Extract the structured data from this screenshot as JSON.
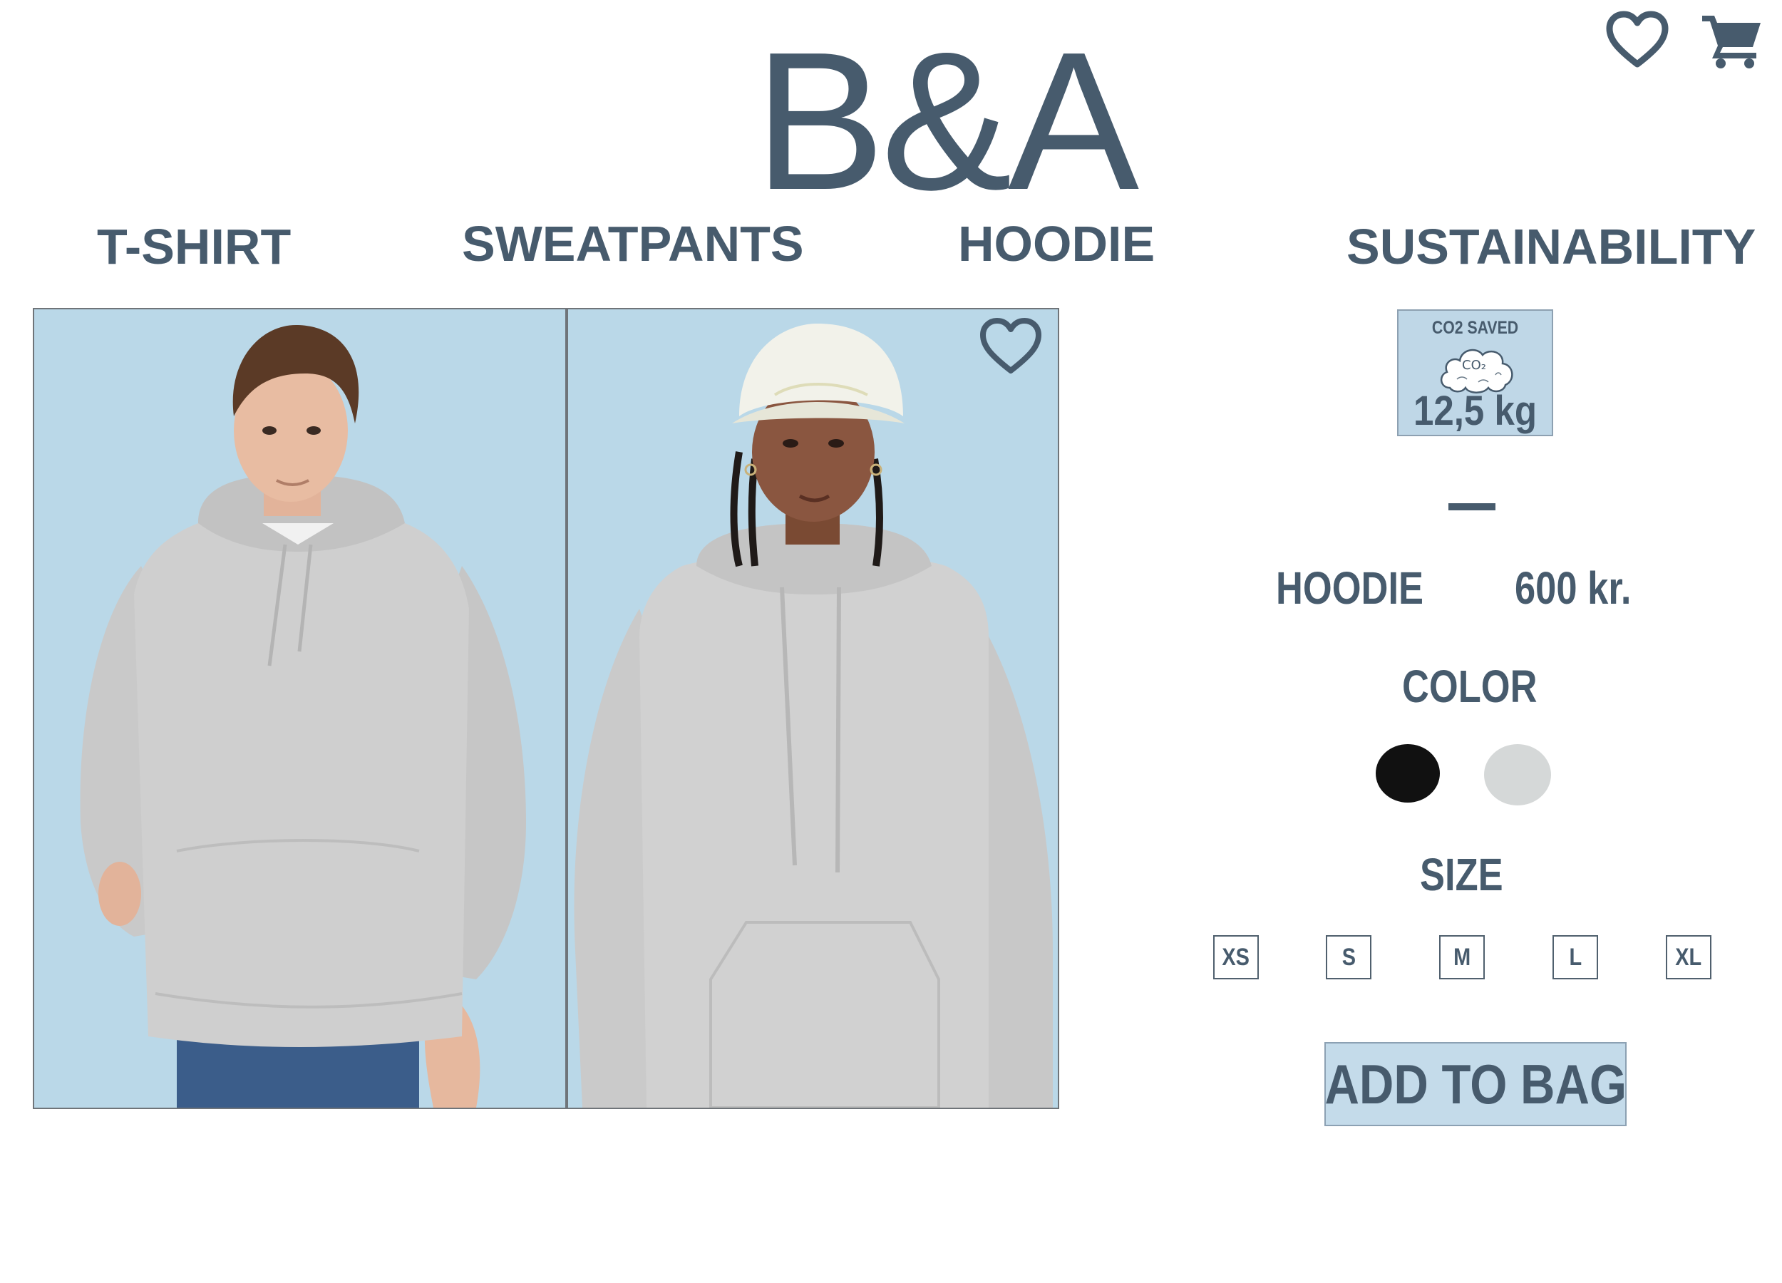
{
  "header": {
    "logo": "B&A",
    "icons": {
      "favorites": "heart-icon",
      "cart": "cart-icon"
    }
  },
  "nav": {
    "items": [
      "T-SHIRT",
      "SWEATPANTS",
      "HOODIE",
      "SUSTAINABILITY"
    ]
  },
  "gallery": {
    "images": [
      "model-man-grey-hoodie",
      "model-woman-grey-hoodie"
    ],
    "favorite_icon": "heart-icon"
  },
  "product": {
    "co2_badge": {
      "title": "CO2 SAVED",
      "cloud_text": "CO₂",
      "value": "12,5 kg"
    },
    "name": "HOODIE",
    "price": "600 kr.",
    "color_label": "COLOR",
    "colors": [
      "#111111",
      "#d5d8d8"
    ],
    "size_label": "SIZE",
    "sizes": [
      "XS",
      "S",
      "M",
      "L",
      "XL"
    ],
    "add_to_bag": "ADD TO BAG"
  },
  "colors": {
    "brand": "#475b6d",
    "photo_bg": "#bad8e8",
    "button_bg": "#c4dbea"
  }
}
